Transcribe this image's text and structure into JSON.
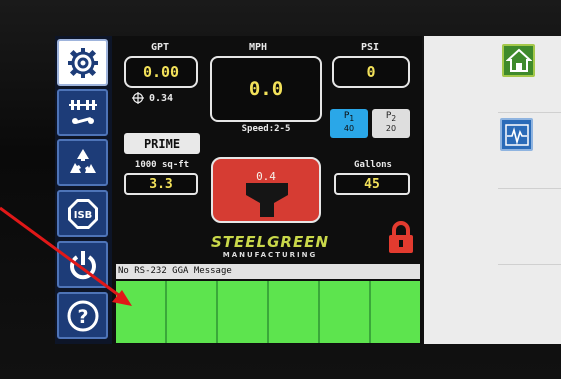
{
  "sidebar": {
    "items": [
      {
        "icon": "gear-icon",
        "active": true
      },
      {
        "icon": "sprayer-hitch-icon",
        "active": false
      },
      {
        "icon": "recycle-icon",
        "active": false
      },
      {
        "icon": "isb-icon",
        "label": "ISB",
        "active": false
      },
      {
        "icon": "power-icon",
        "active": false
      },
      {
        "icon": "help-icon",
        "label": "?",
        "active": false
      }
    ]
  },
  "gauges": {
    "gpt": {
      "label": "GPT",
      "value": "0.00"
    },
    "mph": {
      "label": "MPH",
      "value": "0.0"
    },
    "psi": {
      "label": "PSI",
      "value": "0"
    },
    "gps_value": "0.34",
    "speed_range": "Speed:2-5",
    "prime_label": "PRIME",
    "p1": {
      "label": "P",
      "sub": "1",
      "value": "40"
    },
    "p2": {
      "label": "P",
      "sub": "2",
      "value": "20"
    },
    "area": {
      "label": "1000 sq-ft",
      "value": "3.3"
    },
    "nozzle_value": "0.4",
    "gallons": {
      "label": "Gallons",
      "value": "45"
    }
  },
  "brand": {
    "name": "STEELGREEN",
    "tagline": "MANUFACTURING"
  },
  "status": {
    "message": "No RS-232 GGA Message"
  },
  "sections": {
    "count": 6,
    "color": "#5de44e"
  },
  "right_panel": {
    "buttons": [
      "home-icon",
      "waveform-icon"
    ]
  },
  "colors": {
    "value_yellow": "#f2e15a",
    "sidebar_blue": "#1d3c78",
    "p1_active": "#2aa7e8",
    "nozzle_red": "#d63c33",
    "lock_red": "#e33b2f",
    "section_green": "#5de44e",
    "annotation_arrow": "#e01818"
  }
}
